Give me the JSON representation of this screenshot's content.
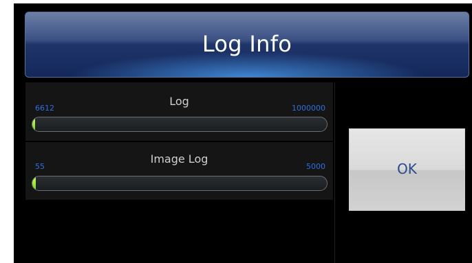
{
  "dialog": {
    "title": "Log Info",
    "ok_label": "OK"
  },
  "logs": [
    {
      "label": "Log",
      "current": "6612",
      "max": "1000000",
      "fraction": 0.006612
    },
    {
      "label": "Image Log",
      "current": "55",
      "max": "5000",
      "fraction": 0.011
    }
  ],
  "colors": {
    "title_gradient": "#1f356a",
    "value_text": "#2f6fe0",
    "progress_fill": "#9be33a",
    "ok_text": "#2b4a8a"
  }
}
